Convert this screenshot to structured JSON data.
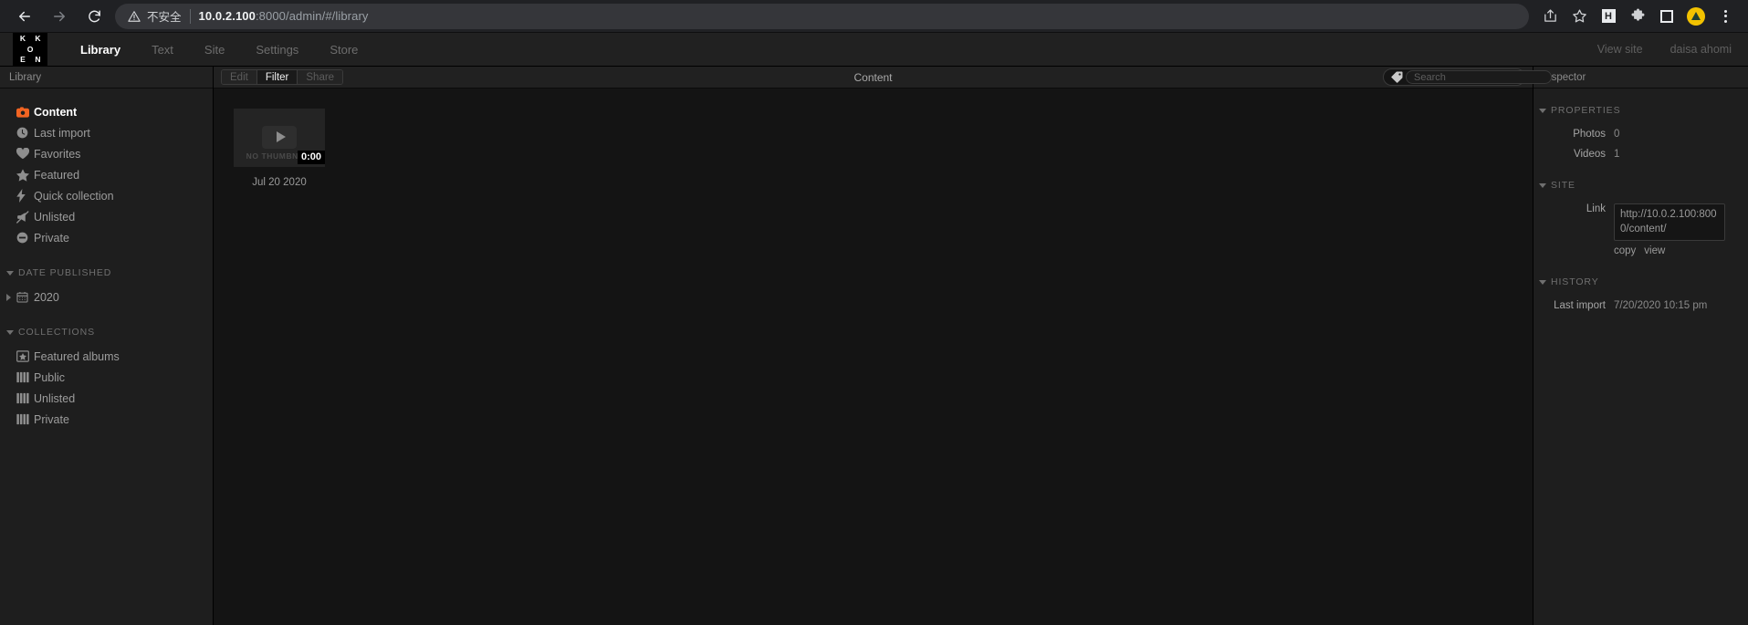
{
  "browser": {
    "back_icon": "arrow-left-icon",
    "forward_icon": "arrow-right-icon",
    "reload_icon": "reload-icon",
    "warning_icon": "warning-triangle-icon",
    "security_label": "不安全",
    "url_host": "10.0.2.100",
    "url_path": ":8000/admin/#/library",
    "toolbar_icons": [
      {
        "name": "share-icon",
        "label": "Share this page"
      },
      {
        "name": "bookmark-star-icon",
        "label": "Bookmark this tab"
      },
      {
        "name": "extension-h-icon",
        "label": "H"
      },
      {
        "name": "puzzle-piece-icon",
        "label": "Extensions"
      },
      {
        "name": "sidebar-square-icon",
        "label": "Side panel"
      },
      {
        "name": "profile-avatar-icon",
        "label": "Profile"
      },
      {
        "name": "kebab-menu-icon",
        "label": "Customize and control"
      }
    ]
  },
  "app_header": {
    "logo": {
      "k1": "K",
      "k2": "K",
      "o": "O",
      "e": "E",
      "n": "N"
    },
    "nav": [
      {
        "label": "Library",
        "active": true
      },
      {
        "label": "Text",
        "active": false
      },
      {
        "label": "Site",
        "active": false
      },
      {
        "label": "Settings",
        "active": false
      },
      {
        "label": "Store",
        "active": false
      }
    ],
    "view_site": "View site",
    "account": "daisa ahomi"
  },
  "sidebar": {
    "title": "Library",
    "items": [
      {
        "label": "Content",
        "icon": "camera-icon",
        "active": true
      },
      {
        "label": "Last import",
        "icon": "clock-icon",
        "active": false
      },
      {
        "label": "Favorites",
        "icon": "heart-icon",
        "active": false
      },
      {
        "label": "Featured",
        "icon": "star-icon",
        "active": false
      },
      {
        "label": "Quick collection",
        "icon": "lightning-bolt-icon",
        "active": false
      },
      {
        "label": "Unlisted",
        "icon": "megaphone-slash-icon",
        "active": false
      },
      {
        "label": "Private",
        "icon": "minus-circle-icon",
        "active": false
      }
    ],
    "date_published": {
      "header": "DATE PUBLISHED",
      "items": [
        {
          "label": "2020",
          "icon": "calendar-icon"
        }
      ]
    },
    "collections": {
      "header": "COLLECTIONS",
      "items": [
        {
          "label": "Featured albums",
          "icon": "star-album-icon"
        },
        {
          "label": "Public",
          "icon": "albums-icon"
        },
        {
          "label": "Unlisted",
          "icon": "albums-icon"
        },
        {
          "label": "Private",
          "icon": "albums-icon"
        }
      ]
    }
  },
  "content": {
    "title": "Content",
    "buttons": [
      {
        "label": "Edit",
        "state": "disabled"
      },
      {
        "label": "Filter",
        "state": "active"
      },
      {
        "label": "Share",
        "state": "disabled"
      }
    ],
    "tag_icon": "tag-icon",
    "search_placeholder": "Search",
    "search_value": "",
    "assets": [
      {
        "thumbnail_text": "NO THUMBNAIL",
        "duration": "0:00",
        "caption": "Jul 20 2020",
        "type": "video"
      }
    ]
  },
  "inspector": {
    "title": "Inspector",
    "properties": {
      "header": "PROPERTIES",
      "rows": [
        {
          "label": "Photos",
          "value": "0"
        },
        {
          "label": "Videos",
          "value": "1"
        }
      ]
    },
    "site": {
      "header": "SITE",
      "link_label": "Link",
      "link_value": "http://10.0.2.100:8000/content/",
      "copy_label": "copy",
      "view_label": "view"
    },
    "history": {
      "header": "HISTORY",
      "rows": [
        {
          "label": "Last import",
          "value": "7/20/2020 10:15 pm"
        }
      ]
    }
  },
  "colors": {
    "accent": "#f26422",
    "chrome_bg": "#202124",
    "app_bg": "#141414",
    "panel_bg": "#1e1e1e",
    "header_bg": "#212121"
  }
}
